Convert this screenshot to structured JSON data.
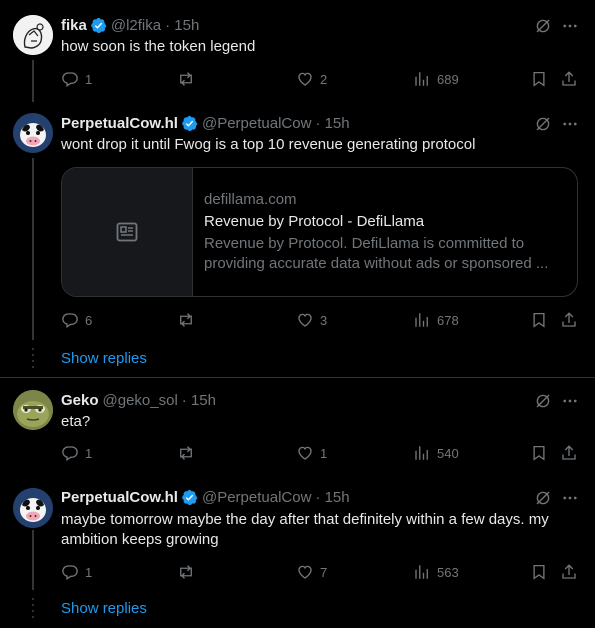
{
  "tweets": [
    {
      "name": "fika",
      "handle": "@l2fika",
      "time": "· 15h",
      "text": "how soon is the token legend",
      "replies": "1",
      "reposts": "",
      "likes": "2",
      "views": "689"
    },
    {
      "name": "PerpetualCow.hl",
      "handle": "@PerpetualCow",
      "time": "· 15h",
      "text": "wont drop it until Fwog is a top 10 revenue generating protocol",
      "card": {
        "domain": "defillama.com",
        "title": "Revenue by Protocol - DefiLlama",
        "description": "Revenue by Protocol. DefiLlama is committed to providing accurate data without ads or sponsored ..."
      },
      "replies": "6",
      "reposts": "",
      "likes": "3",
      "views": "678"
    },
    {
      "name": "Geko",
      "handle": "@geko_sol",
      "time": "· 15h",
      "text": "eta?",
      "replies": "1",
      "reposts": "",
      "likes": "1",
      "views": "540"
    },
    {
      "name": "PerpetualCow.hl",
      "handle": "@PerpetualCow",
      "time": "· 15h",
      "text": "maybe tomorrow maybe the day after that definitely within a few days. my ambition keeps growing",
      "replies": "1",
      "reposts": "",
      "likes": "7",
      "views": "563"
    }
  ],
  "show_replies_label": "Show replies",
  "colors": {
    "background": "#000000",
    "text": "#e7e9ea",
    "muted": "#71767b",
    "accent": "#1d9bf0",
    "border": "#2f3336"
  },
  "icons": [
    "verified-badge-icon",
    "grok-icon",
    "more-icon",
    "reply-icon",
    "repost-icon",
    "like-icon",
    "views-icon",
    "bookmark-icon",
    "share-icon",
    "link-card-icon"
  ]
}
